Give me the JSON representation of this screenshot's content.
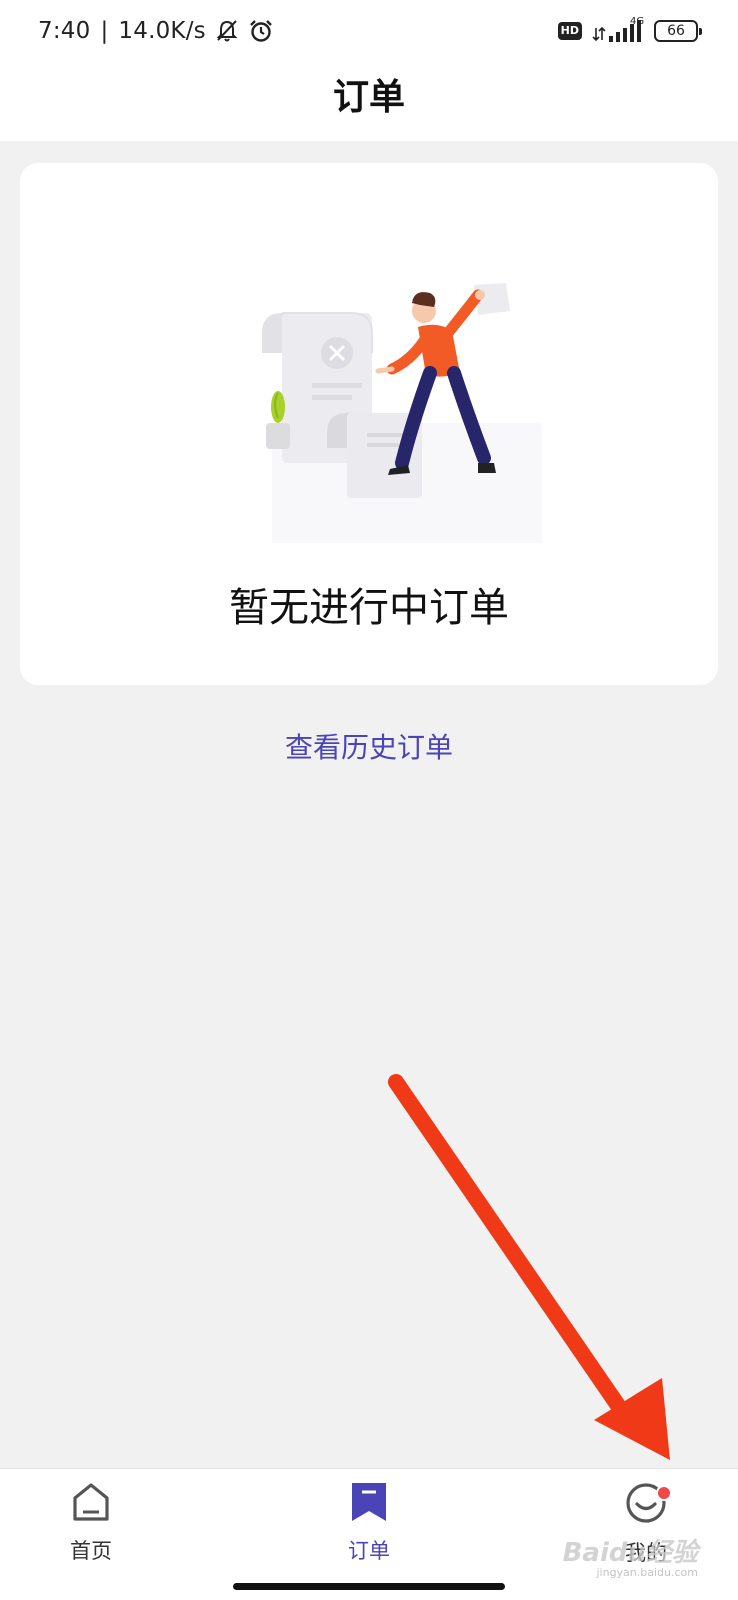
{
  "status_bar": {
    "time": "7:40",
    "separator": "|",
    "net_speed": "14.0K/s",
    "hd_label": "HD",
    "network_type": "4G",
    "battery": "66"
  },
  "header": {
    "title": "订单"
  },
  "empty_state": {
    "message": "暂无进行中订单"
  },
  "history_link": {
    "label": "查看历史订单"
  },
  "bottom_nav": {
    "items": [
      {
        "label": "首页",
        "icon": "home-icon"
      },
      {
        "label": "订单",
        "icon": "bookmark-icon",
        "active": true
      },
      {
        "label": "我的",
        "icon": "profile-icon",
        "has_badge": true
      }
    ]
  },
  "watermark": {
    "text": "Baidu经验",
    "sub": "jingyan.baidu.com"
  },
  "colors": {
    "accent": "#4a44b7",
    "badge": "#f04848",
    "annotation_arrow": "#f03a17",
    "background": "#f1f1f1"
  }
}
